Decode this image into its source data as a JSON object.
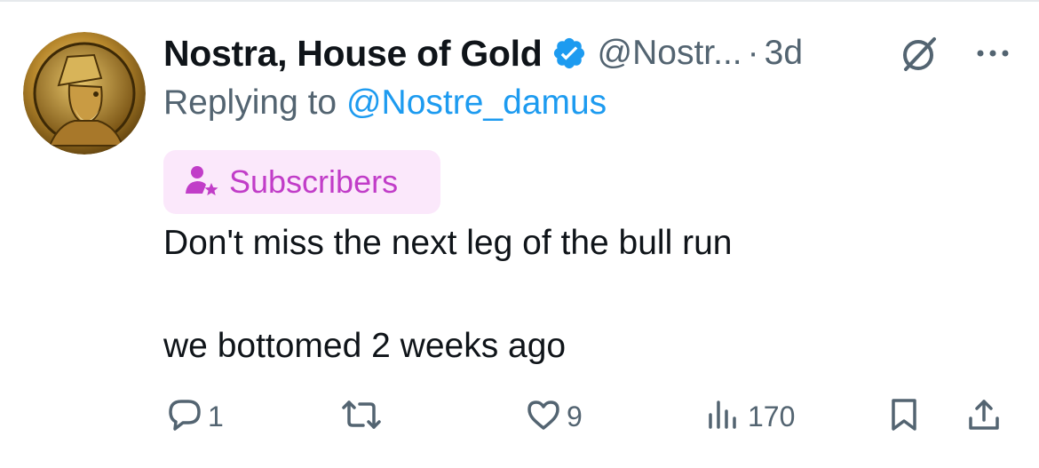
{
  "tweet": {
    "author_name": "Nostra, House of Gold",
    "handle": "@Nostr...",
    "separator": "·",
    "time": "3d",
    "replying_prefix": "Replying to",
    "replying_to": "@Nostre_damus",
    "badge_label": "Subscribers",
    "text_line_1": "Don't miss the next leg of the bull run",
    "text_line_2": "we bottomed 2 weeks ago"
  },
  "actions": {
    "replies": "1",
    "likes": "9",
    "views": "170"
  },
  "icons": {
    "verified": "verified-badge-icon",
    "grok": "grok-icon",
    "more": "more-icon",
    "subscribers": "subscriber-star-icon",
    "reply": "reply-icon",
    "repost": "repost-icon",
    "like": "heart-icon",
    "views": "views-icon",
    "bookmark": "bookmark-icon",
    "share": "share-icon"
  },
  "colors": {
    "text": "#0f1419",
    "secondary": "#536471",
    "link": "#1d9bf0",
    "badge_bg": "#fbe8fb",
    "badge_text": "#c13dc8"
  }
}
